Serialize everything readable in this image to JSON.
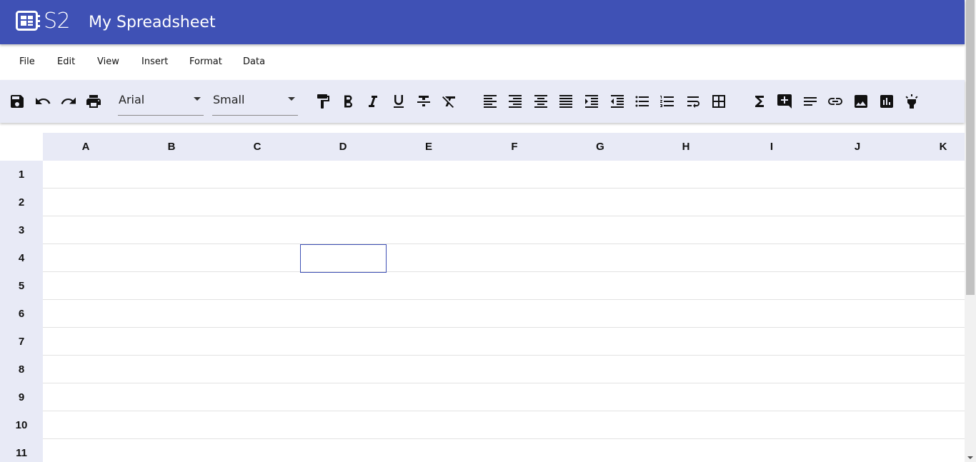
{
  "header": {
    "logo_text": "S2",
    "title": "My Spreadsheet"
  },
  "menu": {
    "items": [
      {
        "label": "File"
      },
      {
        "label": "Edit"
      },
      {
        "label": "View"
      },
      {
        "label": "Insert"
      },
      {
        "label": "Format"
      },
      {
        "label": "Data"
      }
    ]
  },
  "toolbar": {
    "font_family": "Arial",
    "font_size": "Small",
    "icons": [
      "save-icon",
      "undo-icon",
      "redo-icon",
      "print-icon",
      "paint-format-icon",
      "bold-icon",
      "italic-icon",
      "underline-icon",
      "strikethrough-icon",
      "clear-format-icon",
      "align-left-icon",
      "align-right-icon",
      "align-center-icon",
      "align-justify-icon",
      "indent-increase-icon",
      "indent-decrease-icon",
      "bulleted-list-icon",
      "numbered-list-icon",
      "wrap-text-icon",
      "borders-icon",
      "sum-icon",
      "add-comment-icon",
      "notes-icon",
      "link-icon",
      "image-icon",
      "chart-icon",
      "highlight-icon"
    ]
  },
  "grid": {
    "columns": [
      "A",
      "B",
      "C",
      "D",
      "E",
      "F",
      "G",
      "H",
      "I",
      "J",
      "K"
    ],
    "rows": [
      "1",
      "2",
      "3",
      "4",
      "5",
      "6",
      "7",
      "8",
      "9",
      "10",
      "11"
    ],
    "selected_cell": "D4"
  },
  "colors": {
    "primary": "#3f51b5",
    "header_bg": "#e8eaf6"
  }
}
